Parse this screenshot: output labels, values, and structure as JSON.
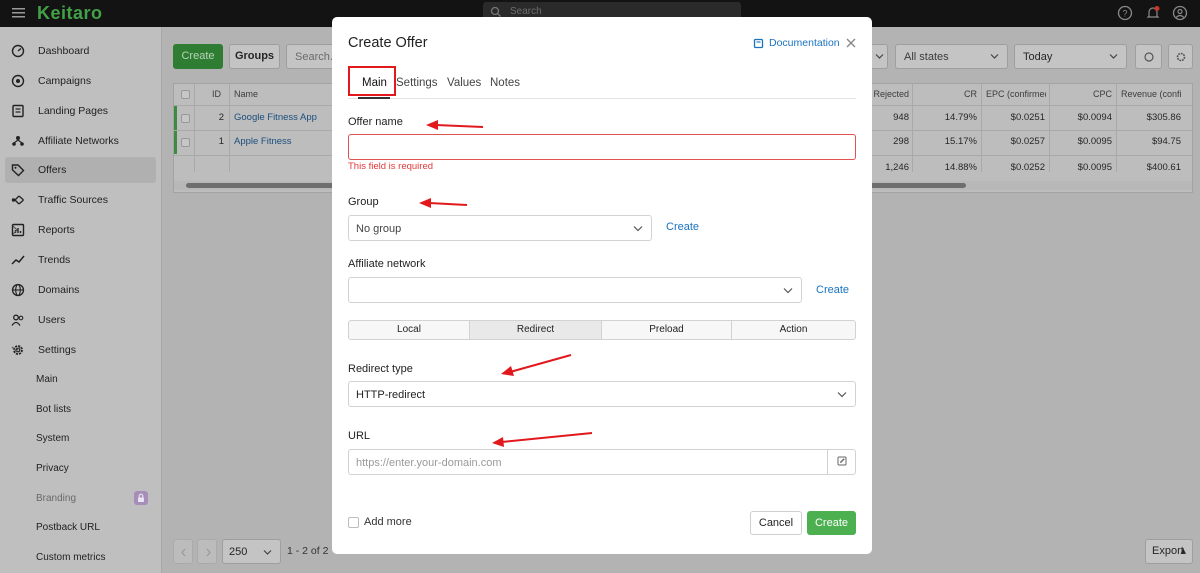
{
  "app": {
    "logo": "Keitaro",
    "search_placeholder": "Search"
  },
  "sidebar": {
    "items": [
      {
        "label": "Dashboard",
        "icon": "dashboard-icon"
      },
      {
        "label": "Campaigns",
        "icon": "target-icon"
      },
      {
        "label": "Landing Pages",
        "icon": "page-icon"
      },
      {
        "label": "Affiliate Networks",
        "icon": "network-icon"
      },
      {
        "label": "Offers",
        "icon": "tag-icon",
        "active": true
      },
      {
        "label": "Traffic Sources",
        "icon": "traffic-icon"
      },
      {
        "label": "Reports",
        "icon": "report-icon"
      },
      {
        "label": "Trends",
        "icon": "trend-icon"
      },
      {
        "label": "Domains",
        "icon": "globe-icon"
      },
      {
        "label": "Users",
        "icon": "users-icon"
      },
      {
        "label": "Settings",
        "icon": "gear-icon"
      }
    ],
    "settings_sub": [
      "Main",
      "Bot lists",
      "System",
      "Privacy",
      "Branding",
      "Postback URL",
      "Custom metrics"
    ]
  },
  "toolbar": {
    "create_label": "Create",
    "groups_label": "Groups",
    "search_placeholder": "Search..",
    "states_label": "All states",
    "date_label": "Today"
  },
  "table": {
    "headers": {
      "id": "ID",
      "name": "Name",
      "rejected": "Rejected",
      "cr": "CR",
      "epc": "EPC (confirmed)",
      "cpc": "CPC",
      "revenue": "Revenue (confi"
    },
    "rows": [
      {
        "id": "2",
        "name": "Google Fitness App",
        "rejected": "948",
        "cr": "14.79%",
        "epc": "$0.0251",
        "cpc": "$0.0094",
        "revenue": "$305.86"
      },
      {
        "id": "1",
        "name": "Apple Fitness",
        "rejected": "298",
        "cr": "15.17%",
        "epc": "$0.0257",
        "cpc": "$0.0095",
        "revenue": "$94.75"
      }
    ],
    "totals": {
      "rejected": "1,246",
      "cr": "14.88%",
      "epc": "$0.0252",
      "cpc": "$0.0095",
      "revenue": "$400.61"
    }
  },
  "pagination": {
    "per_page": "250",
    "range": "1 - 2 of 2"
  },
  "export_label": "Export",
  "modal": {
    "title": "Create Offer",
    "docs_label": "Documentation",
    "tabs": [
      "Main",
      "Settings",
      "Values",
      "Notes"
    ],
    "offer_name_label": "Offer name",
    "offer_name_value": "",
    "offer_name_error": "This field is required",
    "group_label": "Group",
    "group_value": "No group",
    "group_create": "Create",
    "network_label": "Affiliate network",
    "network_value": "",
    "network_create": "Create",
    "action_types": [
      "Local",
      "Redirect",
      "Preload",
      "Action"
    ],
    "action_selected": "Redirect",
    "redirect_type_label": "Redirect type",
    "redirect_type_value": "HTTP-redirect",
    "url_label": "URL",
    "url_placeholder": "https://enter.your-domain.com",
    "add_more_label": "Add more",
    "cancel_label": "Cancel",
    "create_label": "Create"
  },
  "colors": {
    "annotation": "#e1191d",
    "accent": "#4cb050",
    "link": "#1a73c0",
    "error": "#e03838"
  }
}
